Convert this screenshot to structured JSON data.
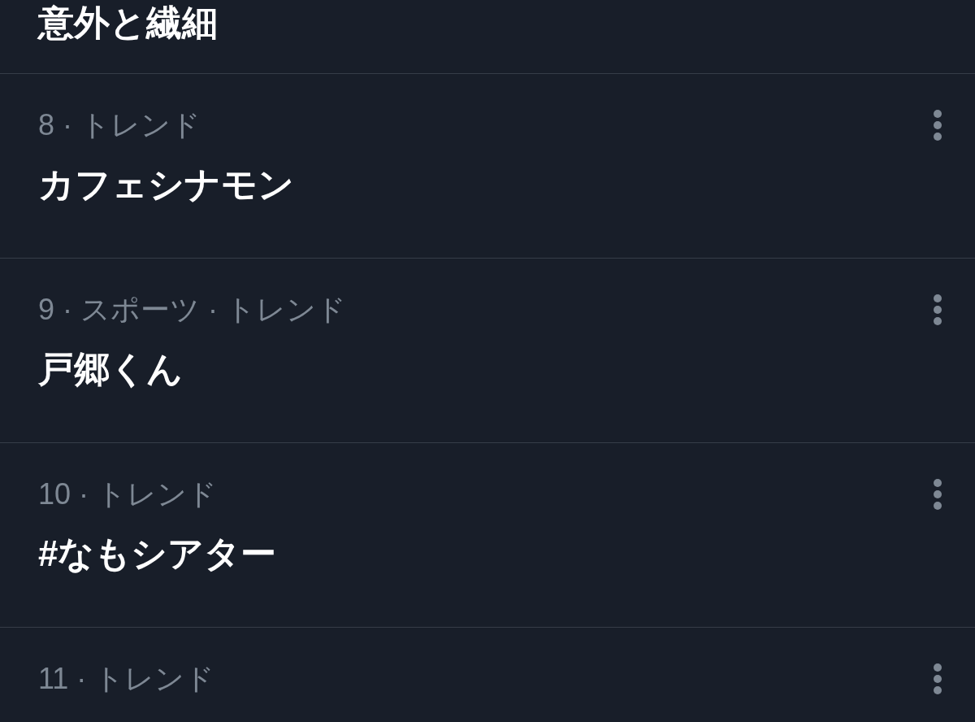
{
  "trends": [
    {
      "title": "意外と繊細"
    },
    {
      "meta": "8 · トレンド",
      "title": "カフェシナモン"
    },
    {
      "meta": "9 · スポーツ · トレンド",
      "title": "戸郷くん"
    },
    {
      "meta": "10 · トレンド",
      "title": "#なもシアター"
    },
    {
      "meta": "11 · トレンド"
    }
  ]
}
